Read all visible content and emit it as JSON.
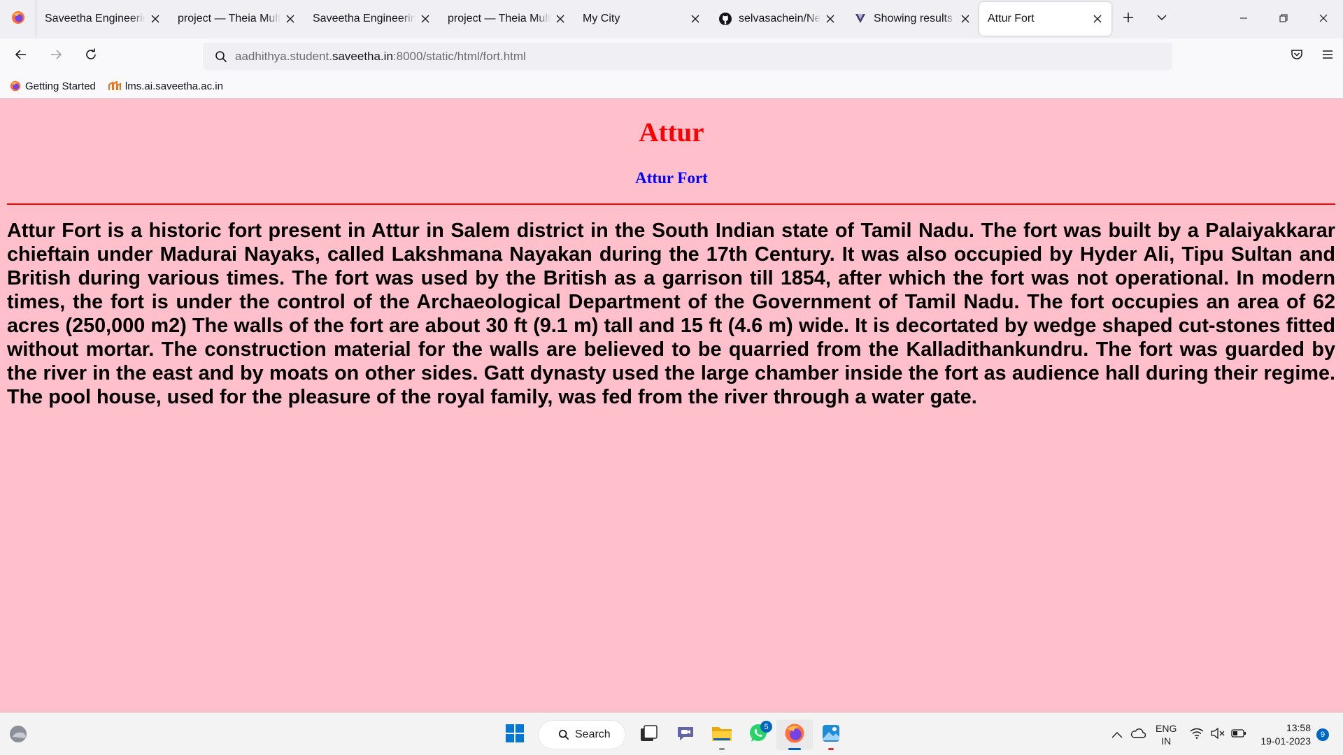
{
  "tabs": [
    {
      "label": "Saveetha Engineering",
      "icon": "none",
      "active": false
    },
    {
      "label": "project — Theia Multi-",
      "icon": "none",
      "active": false
    },
    {
      "label": "Saveetha Engineering",
      "icon": "none",
      "active": false
    },
    {
      "label": "project — Theia Multi-",
      "icon": "none",
      "active": false
    },
    {
      "label": "My City",
      "icon": "none",
      "active": false
    },
    {
      "label": "selvasachein/Near",
      "icon": "github-icon",
      "active": false
    },
    {
      "label": "Showing results fo",
      "icon": "search-results-icon",
      "active": false
    },
    {
      "label": "Attur Fort",
      "icon": "none",
      "active": true
    }
  ],
  "url": {
    "prefix": "aadhithya.student.",
    "host": "saveetha.in",
    "suffix": ":8000/static/html/fort.html"
  },
  "bookmarks": [
    {
      "label": "Getting Started",
      "icon": "firefox-icon"
    },
    {
      "label": "lms.ai.saveetha.ac.in",
      "icon": "lms-icon"
    }
  ],
  "page": {
    "heading": "Attur",
    "subheading": "Attur Fort",
    "body": "Attur Fort is a historic fort present in Attur in Salem district in the South Indian state of Tamil Nadu. The fort was built by a Palaiyakkarar chieftain under Madurai Nayaks, called Lakshmana Nayakan during the 17th Century. It was also occupied by Hyder Ali, Tipu Sultan and British during various times. The fort was used by the British as a garrison till 1854, after which the fort was not operational. In modern times, the fort is under the control of the Archaeological Department of the Government of Tamil Nadu. The fort occupies an area of 62 acres (250,000 m2) The walls of the fort are about 30 ft (9.1 m) tall and 15 ft (4.6 m) wide. It is decortated by wedge shaped cut-stones fitted without mortar. The construction material for the walls are believed to be quarried from the Kalladithankundru. The fort was guarded by the river in the east and by moats on other sides. Gatt dynasty used the large chamber inside the fort as audience hall during their regime. The pool house, used for the pleasure of the royal family, was fed from the river through a water gate.",
    "colors": {
      "background": "#ffc0cb",
      "heading": "#ff0000",
      "subheading": "#0000ff",
      "rule": "#ff0000"
    }
  },
  "taskbar": {
    "search_label": "Search",
    "whatsapp_badge": "5",
    "lang_line1": "ENG",
    "lang_line2": "IN",
    "time": "13:58",
    "date": "19-01-2023",
    "notifications": "9"
  }
}
